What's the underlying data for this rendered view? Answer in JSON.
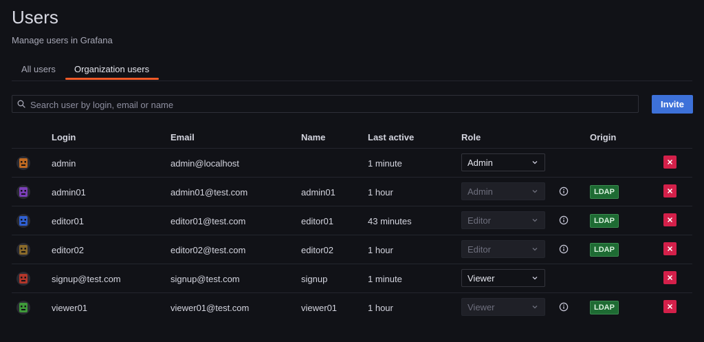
{
  "header": {
    "title": "Users",
    "subtitle": "Manage users in Grafana"
  },
  "tabs": [
    {
      "label": "All users",
      "active": false
    },
    {
      "label": "Organization users",
      "active": true
    }
  ],
  "search": {
    "placeholder": "Search user by login, email or name",
    "value": ""
  },
  "invite_label": "Invite",
  "table": {
    "columns": [
      "Login",
      "Email",
      "Name",
      "Last active",
      "Role",
      "Origin"
    ],
    "rows": [
      {
        "login": "admin",
        "email": "admin@localhost",
        "name": "",
        "last_active": "1 minute",
        "role": "Admin",
        "role_disabled": false,
        "origin": "",
        "avatar_color": "#c06a22"
      },
      {
        "login": "admin01",
        "email": "admin01@test.com",
        "name": "admin01",
        "last_active": "1 hour",
        "role": "Admin",
        "role_disabled": true,
        "origin": "LDAP",
        "avatar_color": "#7b3fb8"
      },
      {
        "login": "editor01",
        "email": "editor01@test.com",
        "name": "editor01",
        "last_active": "43 minutes",
        "role": "Editor",
        "role_disabled": true,
        "origin": "LDAP",
        "avatar_color": "#2f5fd0"
      },
      {
        "login": "editor02",
        "email": "editor02@test.com",
        "name": "editor02",
        "last_active": "1 hour",
        "role": "Editor",
        "role_disabled": true,
        "origin": "LDAP",
        "avatar_color": "#8a6a2a"
      },
      {
        "login": "signup@test.com",
        "email": "signup@test.com",
        "name": "signup",
        "last_active": "1 minute",
        "role": "Viewer",
        "role_disabled": false,
        "origin": "",
        "avatar_color": "#b2362a"
      },
      {
        "login": "viewer01",
        "email": "viewer01@test.com",
        "name": "viewer01",
        "last_active": "1 hour",
        "role": "Viewer",
        "role_disabled": true,
        "origin": "LDAP",
        "avatar_color": "#3f9a3a"
      }
    ]
  },
  "colors": {
    "accent": "#f05a28",
    "primary": "#3d71d9",
    "danger": "#d4204a",
    "ldap_badge": "#1e6b33",
    "background": "#111217"
  }
}
